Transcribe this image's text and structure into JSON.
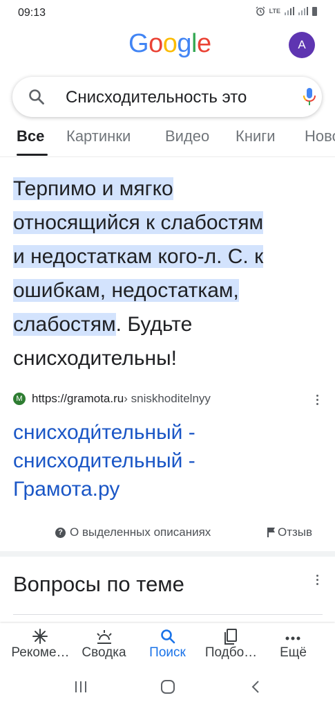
{
  "status": {
    "time": "09:13",
    "network": "LTE"
  },
  "header": {
    "logo": "Google",
    "avatar_letter": "A"
  },
  "search": {
    "query": "Снисходительность это"
  },
  "tabs": [
    {
      "label": "Все"
    },
    {
      "label": "Картинки"
    },
    {
      "label": "Видео"
    },
    {
      "label": "Книги"
    },
    {
      "label": "Новости"
    }
  ],
  "snippet": {
    "highlight_lines": [
      "Терпимо и мягко",
      "относящийся к слабостям",
      "и недостаткам кого-л. С. к",
      "ошибкам, недостаткам,",
      "слабостям"
    ],
    "rest": ". Будьте снисходительны!"
  },
  "result": {
    "favicon_letter": "M",
    "url": "https://gramota.ru",
    "path": " › sniskhoditelnyy",
    "title_lines": [
      "снисходи́тельный -",
      "снисходительный -",
      "Грамота.ру"
    ]
  },
  "feedback": {
    "about": "О выделенных описаниях",
    "feedback": "Отзыв"
  },
  "related": {
    "title": "Вопросы по теме"
  },
  "bottom_nav": [
    {
      "label": "Рекоме…",
      "icon": "sparkle-icon"
    },
    {
      "label": "Сводка",
      "icon": "sunrise-icon"
    },
    {
      "label": "Поиск",
      "icon": "search-icon"
    },
    {
      "label": "Подбо…",
      "icon": "collections-icon"
    },
    {
      "label": "Ещё",
      "icon": "more-icon"
    }
  ],
  "colors": {
    "accent": "#1a73e8",
    "link": "#1a56c6",
    "highlight": "#d3e3fd",
    "avatar": "#5e35b1"
  }
}
